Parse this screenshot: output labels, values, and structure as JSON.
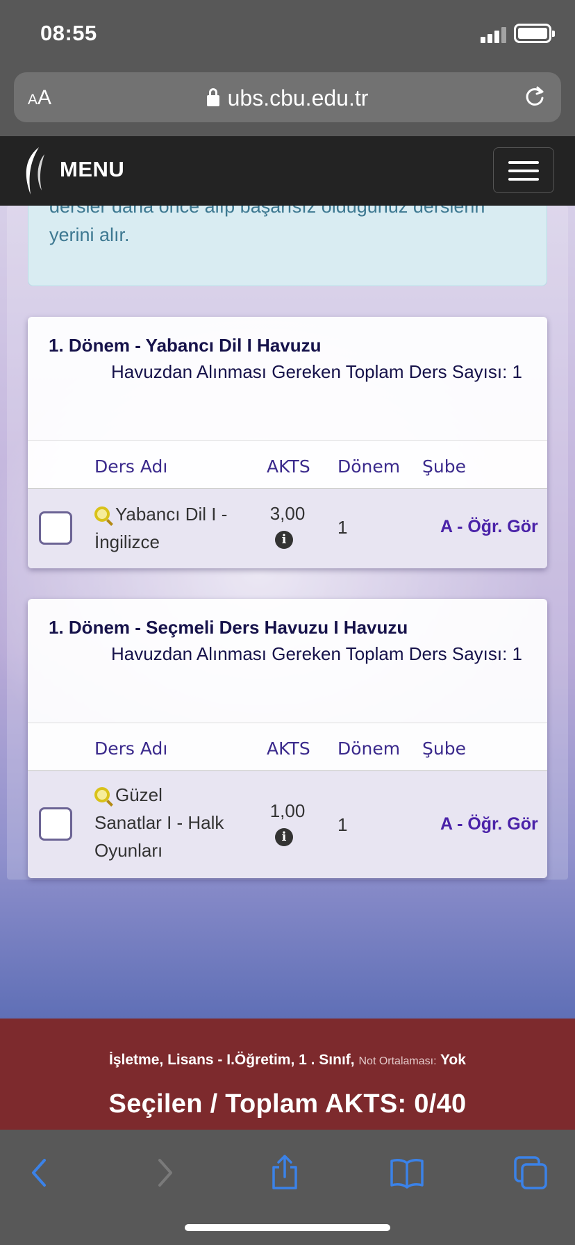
{
  "status": {
    "time": "08:55"
  },
  "browser": {
    "aa_small": "A",
    "aa_large": "A",
    "url": "ubs.cbu.edu.tr"
  },
  "nav": {
    "menu_label": "MENU"
  },
  "info_text": "dersler daha önce alıp başarısız olduğunuz derslerin yerini alır.",
  "table_headers": {
    "name": "Ders Adı",
    "akts": "AKTS",
    "donem": "Dönem",
    "sube": "Şube"
  },
  "pools": [
    {
      "title": "1. Dönem - Yabancı Dil I Havuzu",
      "subtitle": "Havuzdan Alınması Gereken Toplam Ders Sayısı: 1",
      "course": {
        "name_line1": "Yabancı Dil I -",
        "name_line2": "İngilizce",
        "name_line3": "",
        "akts": "3,00",
        "donem": "1",
        "sube": "A - Öğr. Gör",
        "selected": false
      }
    },
    {
      "title": "1. Dönem - Seçmeli Ders Havuzu I Havuzu",
      "subtitle": "Havuzdan Alınması Gereken Toplam Ders Sayısı: 1",
      "course": {
        "name_line1": "Güzel",
        "name_line2": "Sanatlar I - Halk",
        "name_line3": "Oyunları",
        "akts": "1,00",
        "donem": "1",
        "sube": "A - Öğr. Gör",
        "selected": false
      }
    }
  ],
  "footer": {
    "program": "İşletme, Lisans - I.Öğretim, 1 . Sınıf,",
    "gpa_label": "Not Ortalaması:",
    "gpa_value": "Yok",
    "akts_summary": "Seçilen / Toplam AKTS: 0/40"
  },
  "icons": {
    "lock": "lock-icon",
    "reload": "reload-icon",
    "logo": "university-logo",
    "menu": "hamburger-icon",
    "search": "magnifier-icon",
    "info": "info-icon",
    "back": "back-icon",
    "forward": "forward-icon",
    "share": "share-icon",
    "bookmarks": "bookmarks-icon",
    "tabs": "tabs-icon"
  },
  "colors": {
    "navbar": "#232323",
    "footer": "#7d2a2d",
    "accent": "#4a22a8",
    "title": "#16124a",
    "ios_blue": "#3b82e8"
  }
}
